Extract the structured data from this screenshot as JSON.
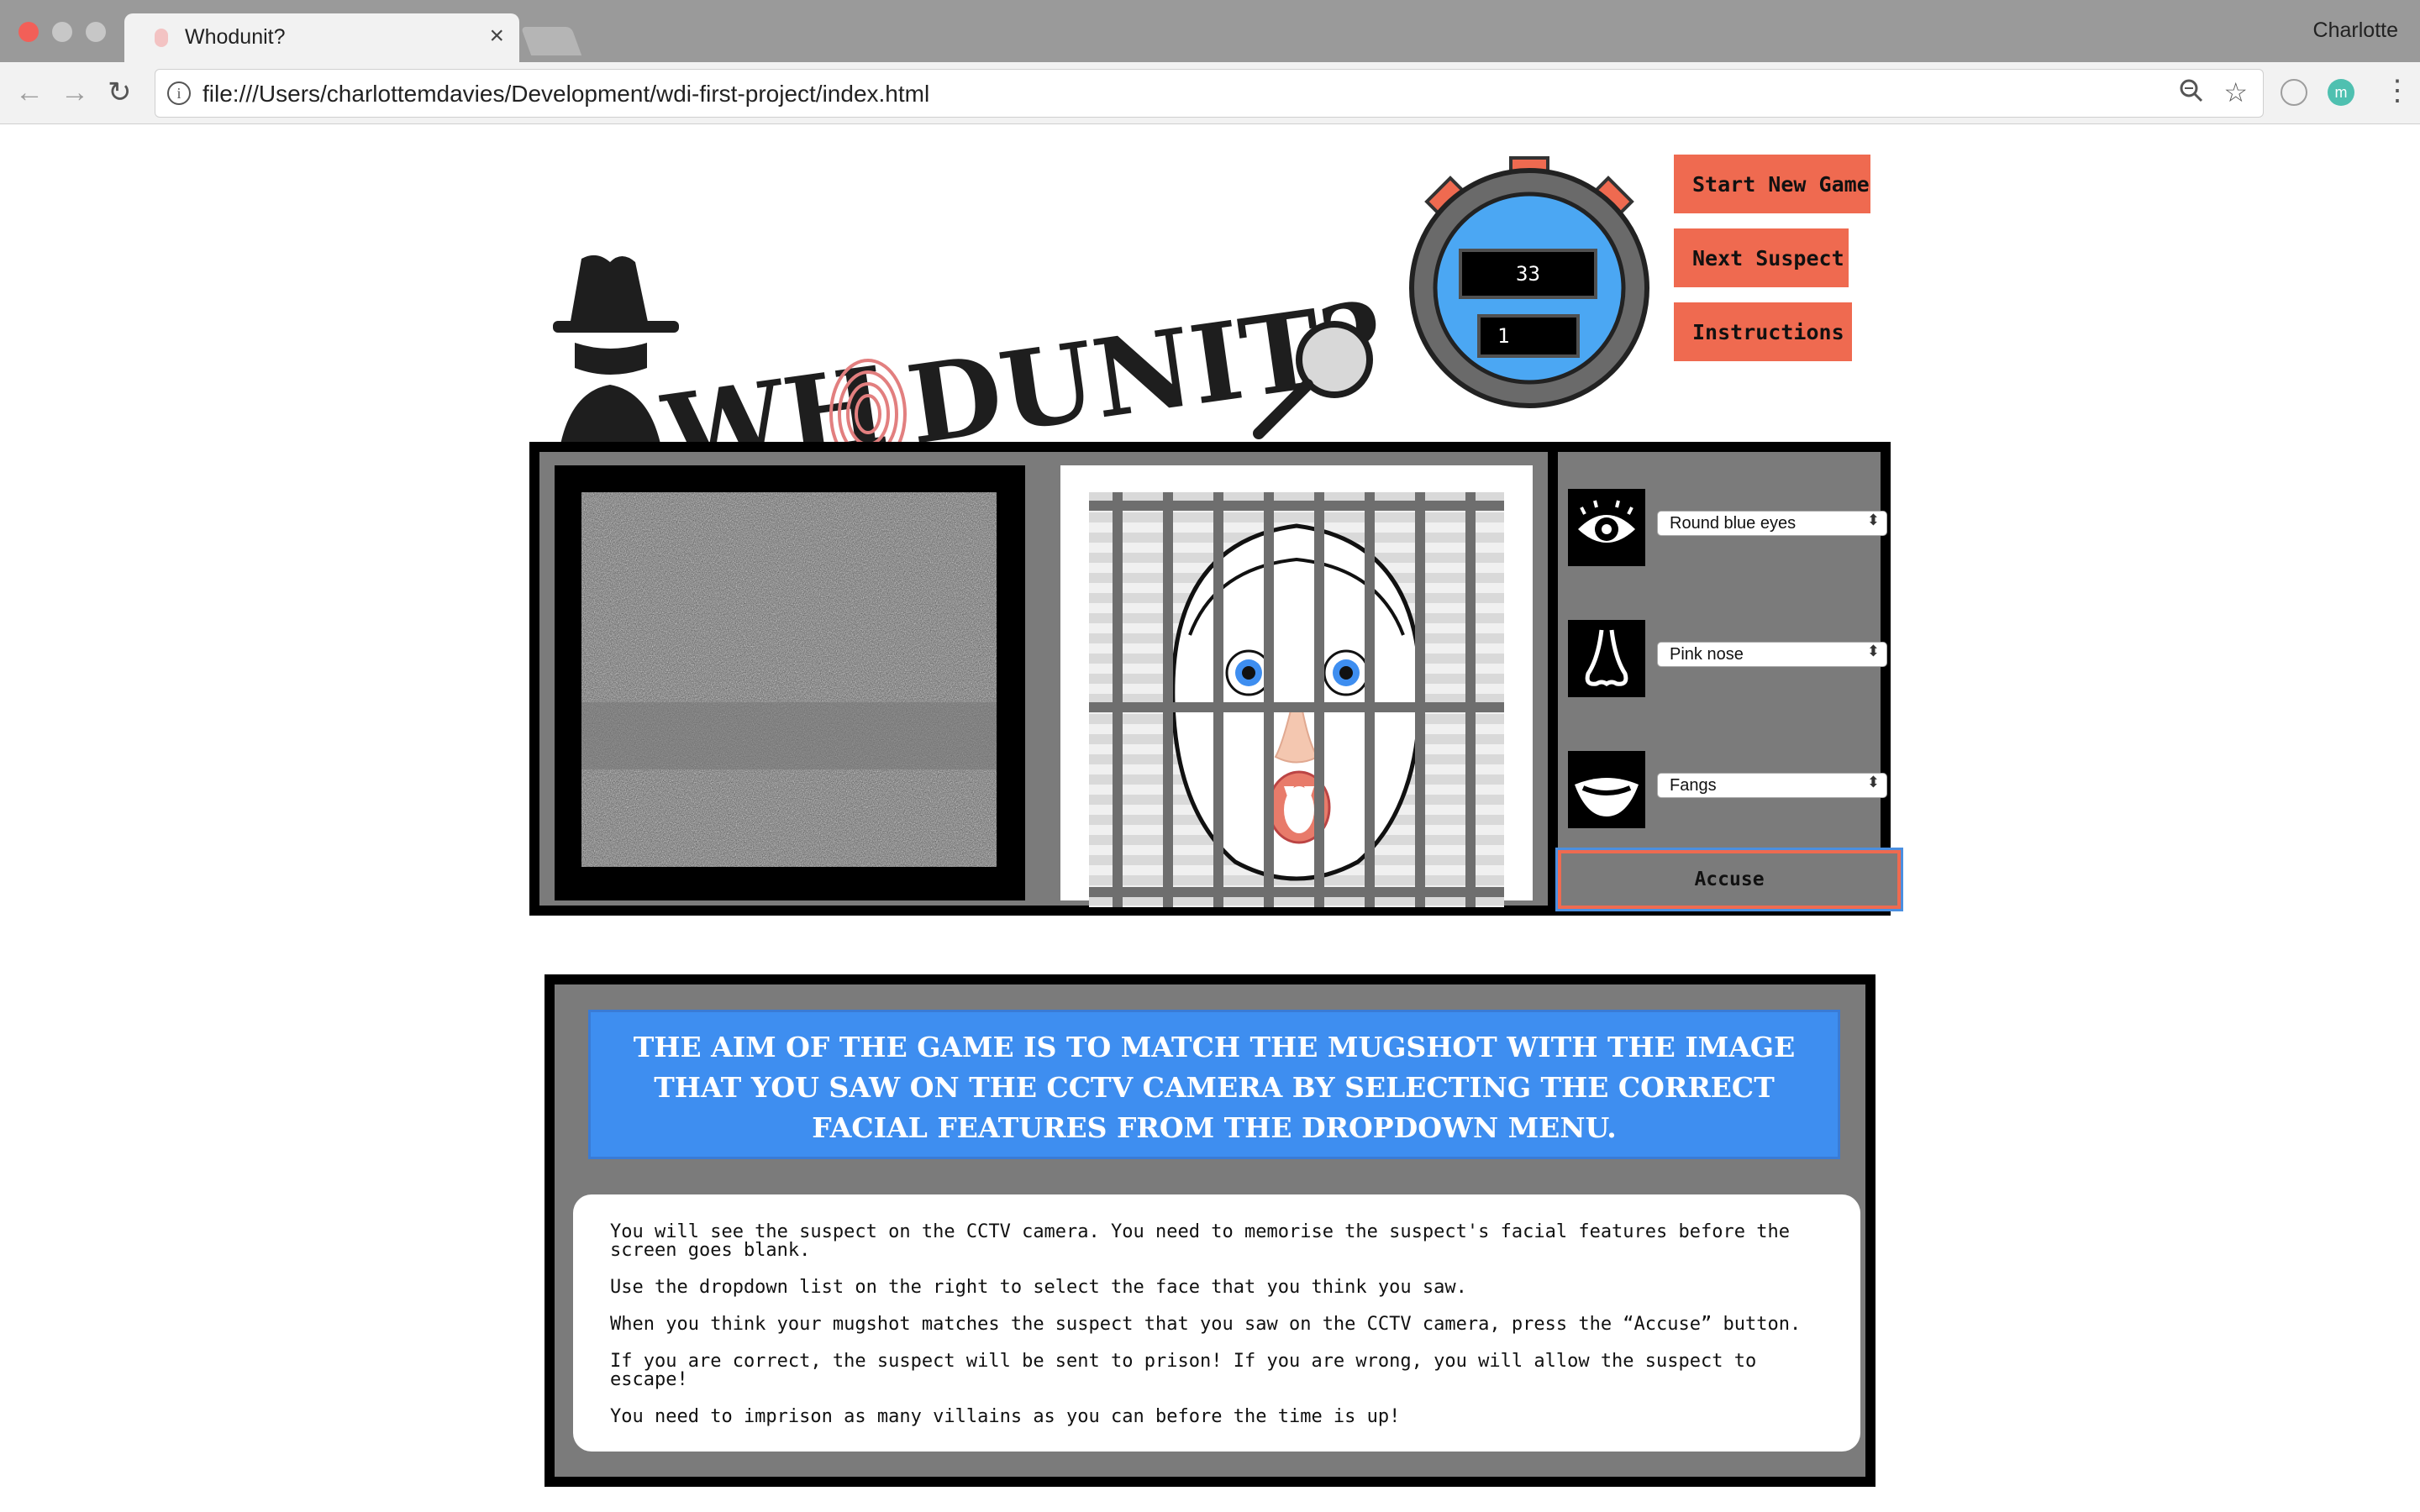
{
  "browser": {
    "tab_title": "Whodunit?",
    "tab_close": "×",
    "profile_name": "Charlotte",
    "url": "file:///Users/charlottemdavies/Development/wdi-first-project/index.html",
    "info_glyph": "i",
    "ext_glyph": "m"
  },
  "logo": {
    "text_left": "WH",
    "text_right": "DUNIT?"
  },
  "stopwatch": {
    "timer": "33",
    "score": "1"
  },
  "buttons": {
    "start": "Start New Game",
    "next": "Next Suspect",
    "instructions": "Instructions"
  },
  "selects": {
    "eyes": "Round blue eyes",
    "nose": "Pink nose",
    "mouth": "Fangs"
  },
  "accuse": "Accuse",
  "instructions": {
    "aim": "The aim of the game is to match the mugshot with the image that you saw on the CCTV camera by selecting the correct facial features from the dropdown menu.",
    "rules": [
      "You will see the suspect on the CCTV camera. You need to memorise the suspect's facial features before the screen goes blank.",
      "Use the dropdown list on the right to select the face that you think you saw.",
      "When you think your mugshot matches the suspect that you saw on the CCTV camera, press the “Accuse” button.",
      "If you are correct, the suspect will be sent to prison! If you are wrong, you will allow the suspect to escape!",
      "You need to imprison as many villains as you can before the time is up!"
    ]
  },
  "colors": {
    "accent_button": "#ef6a50",
    "panel_grey": "#7b7b7b",
    "aim_blue": "#3e8ef0",
    "stopwatch_blue": "#4ba7f3"
  },
  "icons": [
    "back-arrow-icon",
    "forward-arrow-icon",
    "reload-icon",
    "info-icon",
    "zoom-icon",
    "star-icon",
    "menu-icon",
    "detective-icon",
    "fingerprint-icon",
    "magnifier-icon",
    "stopwatch-icon",
    "eye-icon",
    "nose-icon",
    "mouth-icon"
  ]
}
